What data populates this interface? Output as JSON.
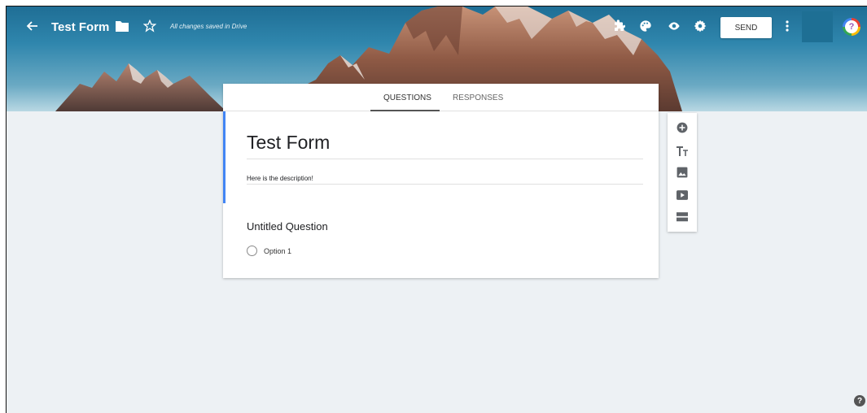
{
  "header": {
    "form_title": "Test Form",
    "save_status": "All changes saved in Drive",
    "send_label": "SEND",
    "back_icon": "arrow-left-icon",
    "folder_icon": "folder-icon",
    "star_icon": "star-outline-icon",
    "addon_icon": "puzzle-icon",
    "palette_icon": "palette-icon",
    "preview_icon": "eye-icon",
    "settings_icon": "gear-icon",
    "more_icon": "more-vert-icon",
    "help_glyph": "?"
  },
  "tabs": [
    {
      "label": "QUESTIONS",
      "active": true
    },
    {
      "label": "RESPONSES",
      "active": false
    }
  ],
  "form": {
    "title": "Test Form",
    "description": "Here is the description!",
    "accent_color": "#4285f4"
  },
  "question": {
    "title": "Untitled Question",
    "options": [
      "Option 1"
    ]
  },
  "side_toolbar": {
    "icons": [
      "add-circle-icon",
      "title-text-icon",
      "image-icon",
      "video-icon",
      "section-icon"
    ]
  },
  "footer": {
    "help_glyph": "?"
  }
}
